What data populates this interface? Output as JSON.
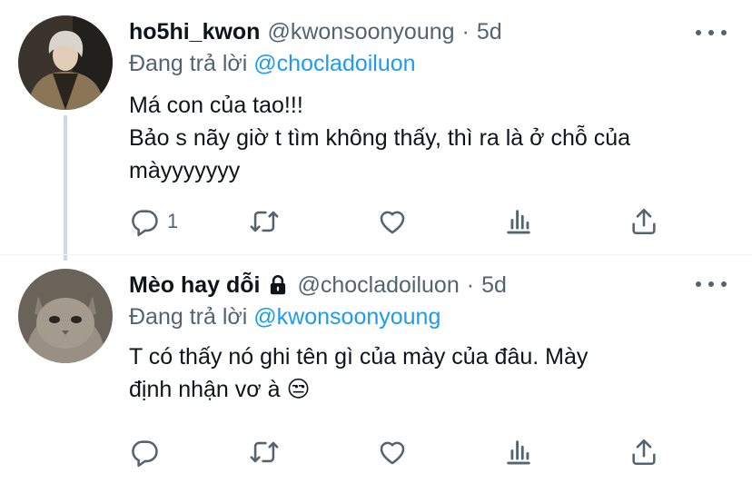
{
  "colors": {
    "accent": "#1d9bf0",
    "secondary_text": "#536471",
    "primary_text": "#0f1419",
    "thread_line": "#cfd9de"
  },
  "tweets": [
    {
      "display_name": "ho5hi_kwon",
      "handle": "@kwonsoonyoung",
      "separator": "·",
      "time": "5d",
      "reply_prefix": "Đang trả lời",
      "reply_to": "@chocladoiluon",
      "body_lines": [
        "Má con của tao!!!",
        "Bảo s nãy giờ t tìm không thấy, thì ra là ở chỗ của",
        "màyyyyyyy"
      ],
      "reply_count": "1",
      "icons": [
        "reply-icon",
        "retweet-icon",
        "like-icon",
        "analytics-icon",
        "share-icon",
        "more-icon"
      ]
    },
    {
      "display_name": "Mèo hay dỗi",
      "protected": true,
      "handle": "@chocladoiluon",
      "separator": "·",
      "time": "5d",
      "reply_prefix": "Đang trả lời",
      "reply_to": "@kwonsoonyoung",
      "body_lines": [
        "T có thấy nó ghi tên gì của mày của đâu. Mày",
        "định nhận vơ à 😒"
      ],
      "reply_count": "",
      "icons": [
        "reply-icon",
        "retweet-icon",
        "like-icon",
        "analytics-icon",
        "share-icon",
        "more-icon",
        "lock-icon"
      ]
    }
  ]
}
